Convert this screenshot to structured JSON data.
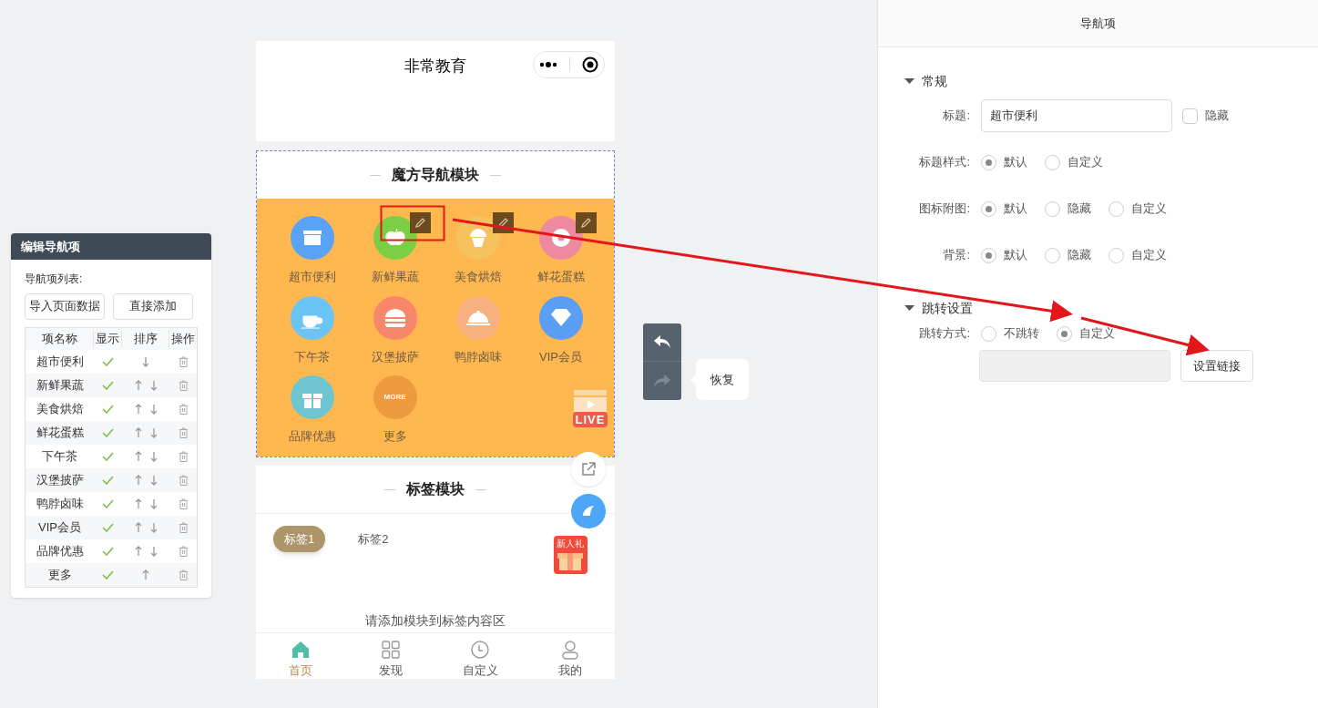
{
  "nav_editor": {
    "title": "编辑导航项",
    "list_label": "导航项列表:",
    "buttons": [
      "导入页面数据",
      "直接添加"
    ],
    "columns": [
      "项名称",
      "显示",
      "排序",
      "操作"
    ],
    "rows": [
      {
        "name": "超市便利",
        "visible": true,
        "move_up": false,
        "move_down": true
      },
      {
        "name": "新鲜果蔬",
        "visible": true,
        "move_up": true,
        "move_down": true
      },
      {
        "name": "美食烘焙",
        "visible": true,
        "move_up": true,
        "move_down": true
      },
      {
        "name": "鲜花蛋糕",
        "visible": true,
        "move_up": true,
        "move_down": true
      },
      {
        "name": "下午茶",
        "visible": true,
        "move_up": true,
        "move_down": true
      },
      {
        "name": "汉堡披萨",
        "visible": true,
        "move_up": true,
        "move_down": true
      },
      {
        "name": "鸭脖卤味",
        "visible": true,
        "move_up": true,
        "move_down": true
      },
      {
        "name": "VIP会员",
        "visible": true,
        "move_up": true,
        "move_down": true
      },
      {
        "name": "品牌优惠",
        "visible": true,
        "move_up": true,
        "move_down": true
      },
      {
        "name": "更多",
        "visible": true,
        "move_up": true,
        "move_down": false
      }
    ]
  },
  "phone": {
    "title": "非常教育",
    "cube_nav": {
      "title": "魔方导航模块",
      "items": [
        {
          "label": "超市便利",
          "color": "#5aa2f5",
          "edit_badge": false
        },
        {
          "label": "新鲜果蔬",
          "color": "#7ccf45",
          "edit_badge": true
        },
        {
          "label": "美食烘焙",
          "color": "#f4c25e",
          "edit_badge": true
        },
        {
          "label": "鲜花蛋糕",
          "color": "#ee8aa0",
          "edit_badge": true
        },
        {
          "label": "下午茶",
          "color": "#6cc4f5",
          "edit_badge": false
        },
        {
          "label": "汉堡披萨",
          "color": "#f7866a",
          "edit_badge": false
        },
        {
          "label": "鸭脖卤味",
          "color": "#f7b07e",
          "edit_badge": false
        },
        {
          "label": "VIP会员",
          "color": "#5a9ef5",
          "edit_badge": false
        },
        {
          "label": "品牌优惠",
          "color": "#70c6d0",
          "edit_badge": false
        },
        {
          "label": "更多",
          "color": "#ee9a3e",
          "edit_badge": false,
          "icon_text": "MORE"
        }
      ]
    },
    "live_badge": "LIVE",
    "gift_badge": "新人礼",
    "tab_module": {
      "title": "标签模块",
      "tabs": [
        {
          "label": "标签1",
          "selected": true
        },
        {
          "label": "标签2",
          "selected": false
        }
      ],
      "empty_text": "请添加模块到标签内容区"
    },
    "tab_bar": [
      {
        "label": "首页",
        "selected": true
      },
      {
        "label": "发现",
        "selected": false
      },
      {
        "label": "自定义",
        "selected": false
      },
      {
        "label": "我的",
        "selected": false
      }
    ]
  },
  "history": {
    "undo_enabled": true,
    "redo_enabled": false,
    "tooltip": "恢复"
  },
  "settings": {
    "title": "导航项",
    "sections": [
      {
        "title": "常规",
        "expanded": true,
        "fields": [
          {
            "kind": "text",
            "label": "标题:",
            "value": "超市便利",
            "checkbox": {
              "label": "隐藏",
              "checked": false
            }
          },
          {
            "kind": "radio",
            "label": "标题样式:",
            "options": [
              {
                "label": "默认",
                "selected": true
              },
              {
                "label": "自定义",
                "selected": false
              }
            ]
          },
          {
            "kind": "radio",
            "label": "图标附图:",
            "options": [
              {
                "label": "默认",
                "selected": true
              },
              {
                "label": "隐藏",
                "selected": false
              },
              {
                "label": "自定义",
                "selected": false
              }
            ]
          },
          {
            "kind": "radio",
            "label": "背景:",
            "options": [
              {
                "label": "默认",
                "selected": true
              },
              {
                "label": "隐藏",
                "selected": false
              },
              {
                "label": "自定义",
                "selected": false
              }
            ]
          }
        ]
      },
      {
        "title": "跳转设置",
        "expanded": true,
        "fields": [
          {
            "kind": "radio",
            "label": "跳转方式:",
            "options": [
              {
                "label": "不跳转",
                "selected": false
              },
              {
                "label": "自定义",
                "selected": true
              }
            ]
          },
          {
            "kind": "link",
            "button": "设置链接"
          }
        ]
      }
    ]
  }
}
